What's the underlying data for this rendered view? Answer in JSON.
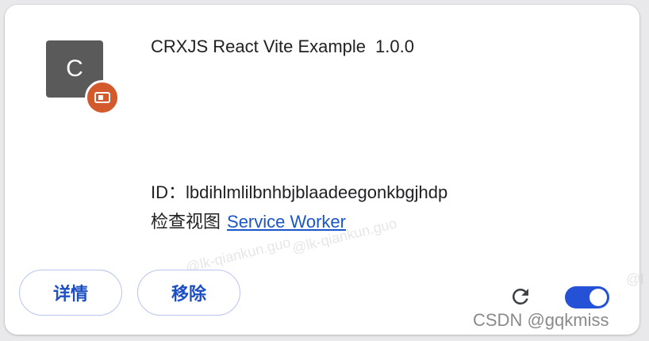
{
  "extension": {
    "icon_letter": "C",
    "badge_icon": "ticket-icon",
    "name": "CRXJS React Vite Example",
    "version": "1.0.0",
    "id_text": "ID：lbdihlmlilbnhbjblaadeegonkbgjhdp",
    "inspect_views_label": "检查视图",
    "service_worker_link": "Service Worker"
  },
  "actions": {
    "details_label": "详情",
    "remove_label": "移除",
    "reload_icon": "reload-icon",
    "enabled": true
  },
  "watermarks": {
    "wm1": "@lk-qiankun.guo",
    "wm2": "@lk-qiankun.guo",
    "wm3": "@l"
  },
  "footer": {
    "credit": "CSDN @gqkmiss"
  },
  "colors": {
    "accent": "#1d4fc4",
    "toggle": "#2551d6",
    "badge": "#d25a2c",
    "link": "#1a55c9"
  }
}
